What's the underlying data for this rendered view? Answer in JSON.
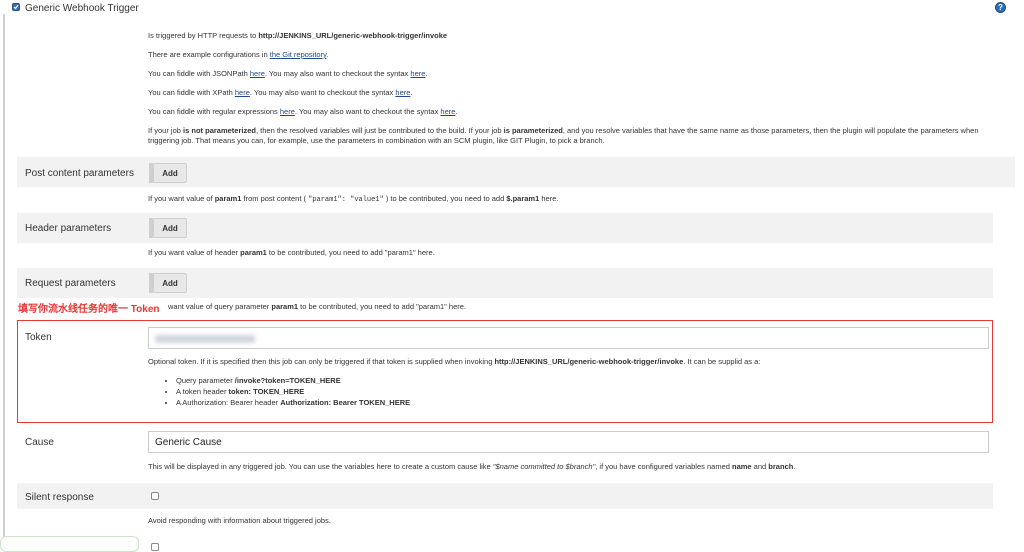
{
  "header": {
    "checkbox_checked": true,
    "title": "Generic Webhook Trigger",
    "help_icon": "help-icon"
  },
  "intro": {
    "line1_pre": "Is triggered by HTTP requests to ",
    "line1_url": "http://JENKINS_URL/generic-webhook-trigger/invoke",
    "line2_pre": "There are example configurations in ",
    "line2_link": "the Git repository",
    "line2_post": ".",
    "line3_pre": "You can fiddle with JSONPath ",
    "line3_link1": "here",
    "line3_mid": ". You may also want to checkout the syntax ",
    "line3_link2": "here",
    "line3_post": ".",
    "line4_pre": "You can fiddle with XPath ",
    "line4_link1": "here",
    "line4_mid": ". You may also want to checkout the syntax ",
    "line4_link2": "here",
    "line4_post": ".",
    "line5_pre": "You can fiddle with regular expressions ",
    "line5_link1": "here",
    "line5_mid": ". You may also want to checkout the syntax ",
    "line5_link2": "here",
    "line5_post": ".",
    "para_a": "If your job ",
    "para_b": "is not parameterized",
    "para_c": ", then the resolved variables will just be contributed to the build. If your job ",
    "para_d": "is parameterized",
    "para_e": ", and you resolve variables that have the same name as those parameters, then the plugin will populate the parameters when triggering job. That means you can, for example, use the parameters in combination with an SCM plugin, like GIT Plugin, to pick a branch."
  },
  "post_content": {
    "label": "Post content parameters",
    "button": "Add",
    "help_a": "If you want value of ",
    "help_b": "param1",
    "help_c": " from post content ( ",
    "help_code": "\"param1\": \"value1\"",
    "help_d": " ) to be contributed, you need to add ",
    "help_e": "$.param1",
    "help_f": " here."
  },
  "header_params": {
    "label": "Header parameters",
    "button": "Add",
    "help_a": "If you want value of header ",
    "help_b": "param1",
    "help_c": " to be contributed, you need to add \"param1\" here."
  },
  "request_params": {
    "label": "Request parameters",
    "button": "Add",
    "help_a": "want value of query parameter ",
    "help_b": "param1",
    "help_c": " to be contributed, you need to add \"param1\" here."
  },
  "annotation": {
    "text": "填写你流水线任务的唯一 Token",
    "color": "#e53935"
  },
  "token": {
    "label": "Token",
    "help_a": "Optional token. If it is specified then this job can only be triggered if that token is supplied when invoking ",
    "help_url": "http://JENKINS_URL/generic-webhook-trigger/invoke",
    "help_b": ". It can be supplid as a:",
    "bullets": [
      {
        "pre": "Query parameter ",
        "bold": "/invoke?token=TOKEN_HERE"
      },
      {
        "pre": "A token header ",
        "bold": "token: TOKEN_HERE"
      },
      {
        "pre": "A Authorization: Bearer header ",
        "bold": "Authorization: Bearer TOKEN_HERE"
      }
    ]
  },
  "cause": {
    "label": "Cause",
    "value": "Generic Cause",
    "help_a": "This will be displayed in any triggered job. You can use the variables here to create a custom cause like ",
    "help_em": "\"$name committed to $branch\"",
    "help_b": ", if you have configured variables named ",
    "help_c": "name",
    "help_d": " and ",
    "help_e": "branch",
    "help_f": "."
  },
  "silent": {
    "label": "Silent response",
    "checked": false,
    "help": "Avoid responding with information about triggered jobs."
  }
}
